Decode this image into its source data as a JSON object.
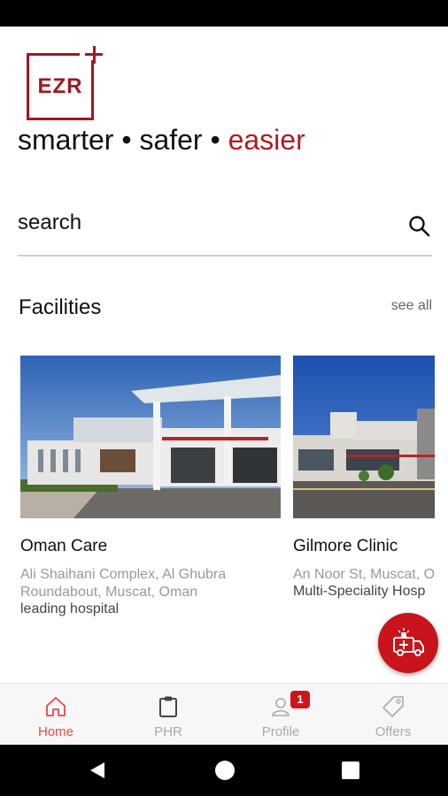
{
  "brand": {
    "logo_text": "EZR",
    "tagline_part1": "smarter • safer • ",
    "tagline_accent": "easier",
    "accent_color": "#b01c22"
  },
  "search": {
    "placeholder": "search",
    "icon": "search-icon"
  },
  "facilities": {
    "title": "Facilities",
    "see_all": "see all",
    "items": [
      {
        "name": "Oman Care",
        "address_line1": "Ali Shaihani Complex, Al Ghubra",
        "address_line2": "Roundabout, Muscat, Oman",
        "description": "leading hospital"
      },
      {
        "name": "Gilmore Clinic",
        "address_line1": "An Noor St, Muscat, O",
        "description": "Multi-Speciality Hosp"
      }
    ]
  },
  "fab": {
    "icon": "ambulance-icon",
    "color": "#c8141a"
  },
  "bottom_nav": {
    "items": [
      {
        "label": "Home",
        "icon": "home-icon",
        "active": true
      },
      {
        "label": "PHR",
        "icon": "clipboard-icon",
        "active": false
      },
      {
        "label": "Profile",
        "icon": "user-icon",
        "active": false,
        "badge": "1"
      },
      {
        "label": "Offers",
        "icon": "tag-icon",
        "active": false
      }
    ]
  }
}
